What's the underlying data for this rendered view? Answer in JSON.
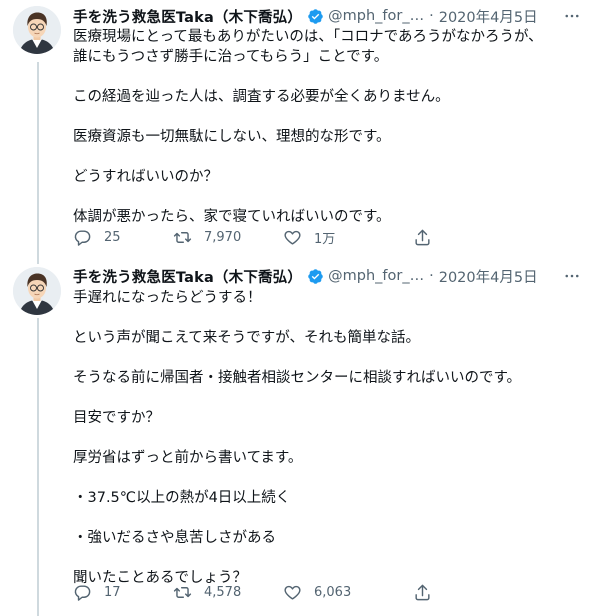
{
  "tweets": [
    {
      "author_name": "手を洗う救急医Taka（木下喬弘）",
      "handle": "@mph_for_…",
      "separator": "·",
      "date": "2020年4月5日",
      "lines": [
        "医療現場にとって最もありがたいのは、「コロナであろうがなかろうが、",
        "誰にもうつさず勝手に治ってもらう」ことです。",
        "",
        "この経過を辿った人は、調査する必要が全くありません。",
        "",
        "医療資源も一切無駄にしない、理想的な形です。",
        "",
        "どうすればいいのか？",
        "",
        "体調が悪かったら、家で寝ていればいいのです。"
      ],
      "replies": "25",
      "retweets": "7,970",
      "likes": "1万"
    },
    {
      "author_name": "手を洗う救急医Taka（木下喬弘）",
      "handle": "@mph_for_…",
      "separator": "·",
      "date": "2020年4月5日",
      "lines": [
        "手遅れになったらどうする！",
        "",
        "という声が聞こえて来そうですが、それも簡単な話。",
        "",
        "そうなる前に帰国者・接触者相談センターに相談すればいいのです。",
        "",
        "目安ですか？",
        "",
        "厚労省はずっと前から書いてます。",
        "",
        "・37.5℃以上の熱が4日以上続く",
        "",
        "・強いだるさや息苦しさがある",
        "",
        "聞いたことあるでしょう？"
      ],
      "replies": "17",
      "retweets": "4,578",
      "likes": "6,063"
    }
  ],
  "icons": {
    "avatar": "avatar-icon",
    "verified": "verified-badge-icon",
    "more": "more-icon",
    "reply": "reply-icon",
    "retweet": "retweet-icon",
    "like": "like-icon",
    "share": "share-icon"
  },
  "colors": {
    "text": "#0f1419",
    "secondary": "#536471",
    "verified": "#1d9bf0",
    "thread_line": "#cfd9de"
  }
}
